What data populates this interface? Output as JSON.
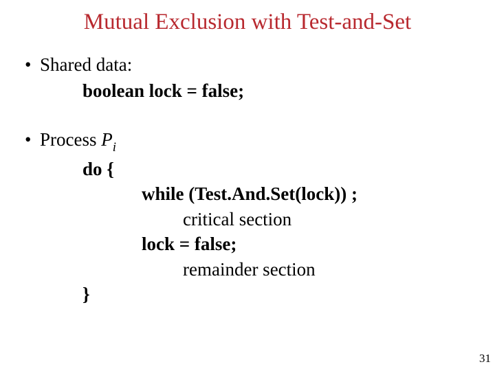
{
  "title": "Mutual Exclusion with Test-and-Set",
  "b1": "Shared data:",
  "b1a": "boolean lock = false;",
  "b2_pre": "Process ",
  "b2_P": "P",
  "b2_i": "i",
  "c1": "do {",
  "c2": "while (Test.And.Set(lock)) ;",
  "c3": "critical section",
  "c4": "lock = false;",
  "c5": "remainder section",
  "c6": "}",
  "page": "31"
}
